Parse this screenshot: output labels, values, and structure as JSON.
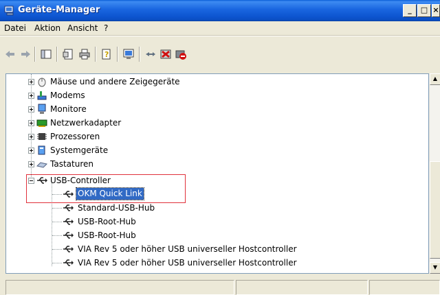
{
  "window": {
    "title": "Geräte-Manager",
    "minimize": "_",
    "maximize": "□",
    "close": "×"
  },
  "menu": [
    "Datei",
    "Aktion",
    "Ansicht",
    "?"
  ],
  "toolbar": {
    "icons": [
      "back-icon",
      "forward-icon",
      "console-tree-icon",
      "properties-icon",
      "print-icon",
      "help-icon",
      "scan-hardware-icon",
      "update-driver-icon",
      "uninstall-icon",
      "disable-icon"
    ]
  },
  "tree": {
    "categories": [
      {
        "label": "Mäuse und andere Zeigegeräte",
        "icon": "mouse-icon"
      },
      {
        "label": "Modems",
        "icon": "modem-icon"
      },
      {
        "label": "Monitore",
        "icon": "monitor-icon"
      },
      {
        "label": "Netzwerkadapter",
        "icon": "network-adapter-icon"
      },
      {
        "label": "Prozessoren",
        "icon": "processor-icon"
      },
      {
        "label": "Systemgeräte",
        "icon": "system-device-icon"
      },
      {
        "label": "Tastaturen",
        "icon": "keyboard-icon"
      }
    ],
    "usb_controller": {
      "label": "USB-Controller",
      "icon": "usb-icon",
      "children": [
        {
          "label": "OKM Quick Link",
          "selected": true
        },
        {
          "label": "Standard-USB-Hub"
        },
        {
          "label": "USB-Root-Hub"
        },
        {
          "label": "USB-Root-Hub"
        },
        {
          "label": "VIA Rev 5 oder höher USB universeller Hostcontroller"
        },
        {
          "label": "VIA Rev 5 oder höher USB universeller Hostcontroller"
        }
      ]
    }
  },
  "colors": {
    "titlebar": "#0d55d0",
    "selection": "#316ac5",
    "highlight_box": "#e0303a"
  }
}
